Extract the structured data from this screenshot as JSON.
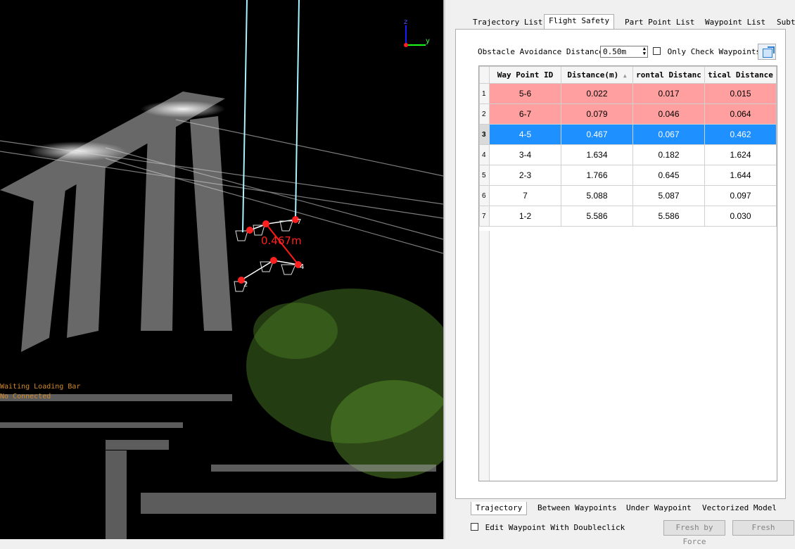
{
  "viewport": {
    "distance_label": "0.467m",
    "waypoint_labels": [
      "2",
      "3",
      "4",
      "5",
      "6",
      "7"
    ],
    "axis_labels": {
      "z": "z",
      "y": "y"
    },
    "overlay_text": [
      "Waiting Loading Bar",
      "No Connected"
    ]
  },
  "tabs": [
    "Trajectory List",
    "Flight Safety",
    "Part Point List",
    "Waypoint List",
    "Subt"
  ],
  "active_tab": "Flight Safety",
  "obstacle": {
    "label": "Obstacle Avoidance Distance:",
    "value": "0.50m",
    "only_check_label": "Only Check Waypoints"
  },
  "table": {
    "headers": [
      "Way Point ID",
      "Distance(m)",
      "rontal Distanc",
      "tical Distance"
    ],
    "rows": [
      {
        "n": "1",
        "id": "5-6",
        "d": "0.022",
        "h": "0.017",
        "v": "0.015",
        "state": "alert"
      },
      {
        "n": "2",
        "id": "6-7",
        "d": "0.079",
        "h": "0.046",
        "v": "0.064",
        "state": "alert"
      },
      {
        "n": "3",
        "id": "4-5",
        "d": "0.467",
        "h": "0.067",
        "v": "0.462",
        "state": "sel"
      },
      {
        "n": "4",
        "id": "3-4",
        "d": "1.634",
        "h": "0.182",
        "v": "1.624",
        "state": ""
      },
      {
        "n": "5",
        "id": "2-3",
        "d": "1.766",
        "h": "0.645",
        "v": "1.644",
        "state": ""
      },
      {
        "n": "6",
        "id": "7",
        "d": "5.088",
        "h": "5.087",
        "v": "0.097",
        "state": ""
      },
      {
        "n": "7",
        "id": "1-2",
        "d": "5.586",
        "h": "5.586",
        "v": "0.030",
        "state": ""
      }
    ]
  },
  "bottom_tabs": [
    "Trajectory",
    "Between Waypoints",
    "Under Waypoint",
    "Vectorized Model"
  ],
  "edit_label": "Edit Waypoint With Doubleclick",
  "buttons": {
    "fresh_force": "Fresh by Force",
    "fresh": "Fresh"
  }
}
